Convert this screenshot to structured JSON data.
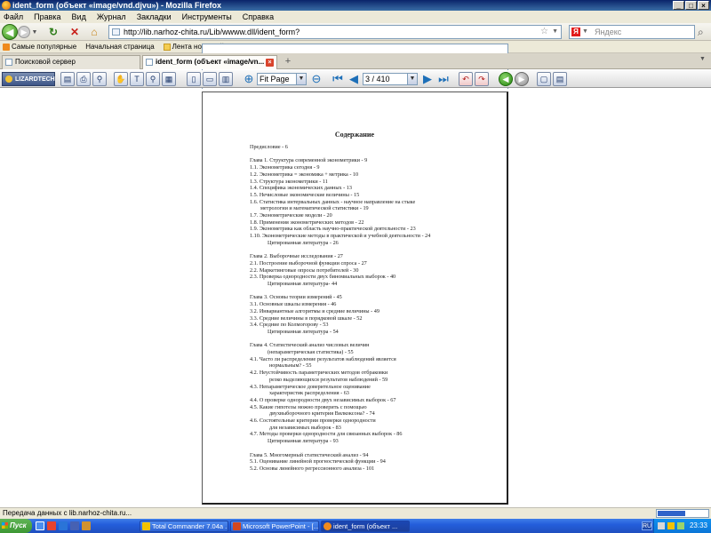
{
  "window": {
    "title": "ident_form (объект «image/vnd.djvu») - Mozilla Firefox",
    "buttons": [
      "_",
      "□",
      "×"
    ]
  },
  "menu": [
    "Файл",
    "Правка",
    "Вид",
    "Журнал",
    "Закладки",
    "Инструменты",
    "Справка"
  ],
  "nav": {
    "url": "http://lib.narhoz-chita.ru/Lib/wwww.dll/ident_form?",
    "search_placeholder": "Яндекс"
  },
  "bookmarks": [
    "Самые популярные",
    "Начальная страница",
    "Лента новостей"
  ],
  "tabs": [
    {
      "label": "Поисковой сервер",
      "active": false
    },
    {
      "label": "ident_form (объект «image/vn...",
      "active": true
    }
  ],
  "djvu": {
    "logo": "LIZARDTECH",
    "zoom": "Fit Page",
    "page": "3 / 410"
  },
  "document": {
    "title": "Содержание",
    "lines": [
      {
        "text": "Предисловие - 6",
        "indent": 0
      },
      {
        "text": "",
        "indent": -1
      },
      {
        "text": "Глава 1. Структура современной эконометрики - 9",
        "indent": 0
      },
      {
        "text": "1.1. Эконометрика сегодня - 9",
        "indent": 0
      },
      {
        "text": "1.2. Эконометрика = экономика + метрика - 10",
        "indent": 0
      },
      {
        "text": "1.3. Структура эконометрики - 11",
        "indent": 0
      },
      {
        "text": "1.4. Специфика экономических данных - 13",
        "indent": 0
      },
      {
        "text": "1.5. Нечисловые экономические величины - 15",
        "indent": 0
      },
      {
        "text": "1.6. Статистика интервальных данных - научное направление на стыке",
        "indent": 0
      },
      {
        "text": "метрологии и математической статистики - 19",
        "indent": 1
      },
      {
        "text": "1.7. Эконометрические модели - 20",
        "indent": 0
      },
      {
        "text": "1.8. Применения эконометрических методов - 22",
        "indent": 0
      },
      {
        "text": "1.9. Эконометрика как область научно-практической деятельности - 23",
        "indent": 0
      },
      {
        "text": "1.10. Эконометрические методы в практической и учебной деятельности - 24",
        "indent": 0
      },
      {
        "text": "Цитированная литература - 26",
        "indent": 2
      },
      {
        "text": "",
        "indent": -1
      },
      {
        "text": "Глава 2. Выборочные исследования - 27",
        "indent": 0
      },
      {
        "text": "2.1. Построение выборочной функции спроса - 27",
        "indent": 0
      },
      {
        "text": "2.2. Маркетинговые опросы потребителей - 30",
        "indent": 0
      },
      {
        "text": "2.3. Проверка однородности двух биномиальных выборок - 40",
        "indent": 0
      },
      {
        "text": "Цитированная литература- 44",
        "indent": 2
      },
      {
        "text": "",
        "indent": -1
      },
      {
        "text": "Глава 3. Основы теории измерений - 45",
        "indent": 0
      },
      {
        "text": "3.1. Основные шкалы измерения - 46",
        "indent": 0
      },
      {
        "text": "3.2. Инвариантные алгоритмы и средние величины - 49",
        "indent": 0
      },
      {
        "text": "3.3. Средние величины в порядковой шкале - 52",
        "indent": 0
      },
      {
        "text": "3.4. Средние по Колмогорову - 53",
        "indent": 0
      },
      {
        "text": "Цитированная литература - 54",
        "indent": 2
      },
      {
        "text": "",
        "indent": -1
      },
      {
        "text": "Глава 4. Статистический анализ числовых величин",
        "indent": 0
      },
      {
        "text": "(непараметрическая статистика) - 55",
        "indent": 2
      },
      {
        "text": "4.1. Часто ли распределение результатов наблюдений является",
        "indent": 0
      },
      {
        "text": "нормальным? - 55",
        "indent": 3
      },
      {
        "text": "4.2. Неустойчивость параметрических методов отбраковки",
        "indent": 0
      },
      {
        "text": "резко выделяющихся результатов наблюдений - 59",
        "indent": 3
      },
      {
        "text": "4.3. Непараметрическое доверительное оценивание",
        "indent": 0
      },
      {
        "text": "характеристик распределения - 63",
        "indent": 3
      },
      {
        "text": "4.4. О проверке однородности двух независимых выборок - 67",
        "indent": 0
      },
      {
        "text": "4.5. Какие гипотезы можно проверить с помощью",
        "indent": 0
      },
      {
        "text": "двухвыборочного критерия Вилкоксона? - 74",
        "indent": 3
      },
      {
        "text": "4.6. Состоятельные критерии проверки однородности",
        "indent": 0
      },
      {
        "text": "для независимых выборок - 83",
        "indent": 3
      },
      {
        "text": "4.7. Методы проверки однородности для связанных выборок - 86",
        "indent": 0
      },
      {
        "text": "Цитированная литература - 93",
        "indent": 2
      },
      {
        "text": "",
        "indent": -1
      },
      {
        "text": "Глава 5. Многомерный статистический анализ - 94",
        "indent": 0
      },
      {
        "text": "5.1. Оценивание линейной прогностической функции - 94",
        "indent": 0
      },
      {
        "text": "5.2. Основы линейного регрессионного анализа - 101",
        "indent": 0
      }
    ]
  },
  "status": {
    "text": "Передача данных с lib.narhoz-chita.ru...",
    "progress": 0.55
  },
  "taskbar": {
    "start": "Пуск",
    "tasks": [
      {
        "label": "Total Commander 7.04a ...",
        "active": false
      },
      {
        "label": "Microsoft PowerPoint - [...",
        "active": false
      },
      {
        "label": "ident_form (объект ...",
        "active": true
      }
    ],
    "lang": "RU",
    "clock": "23:33"
  },
  "colors": {
    "titlebar": "#0a246a",
    "taskbar": "#245edb",
    "start": "#3d9734"
  }
}
